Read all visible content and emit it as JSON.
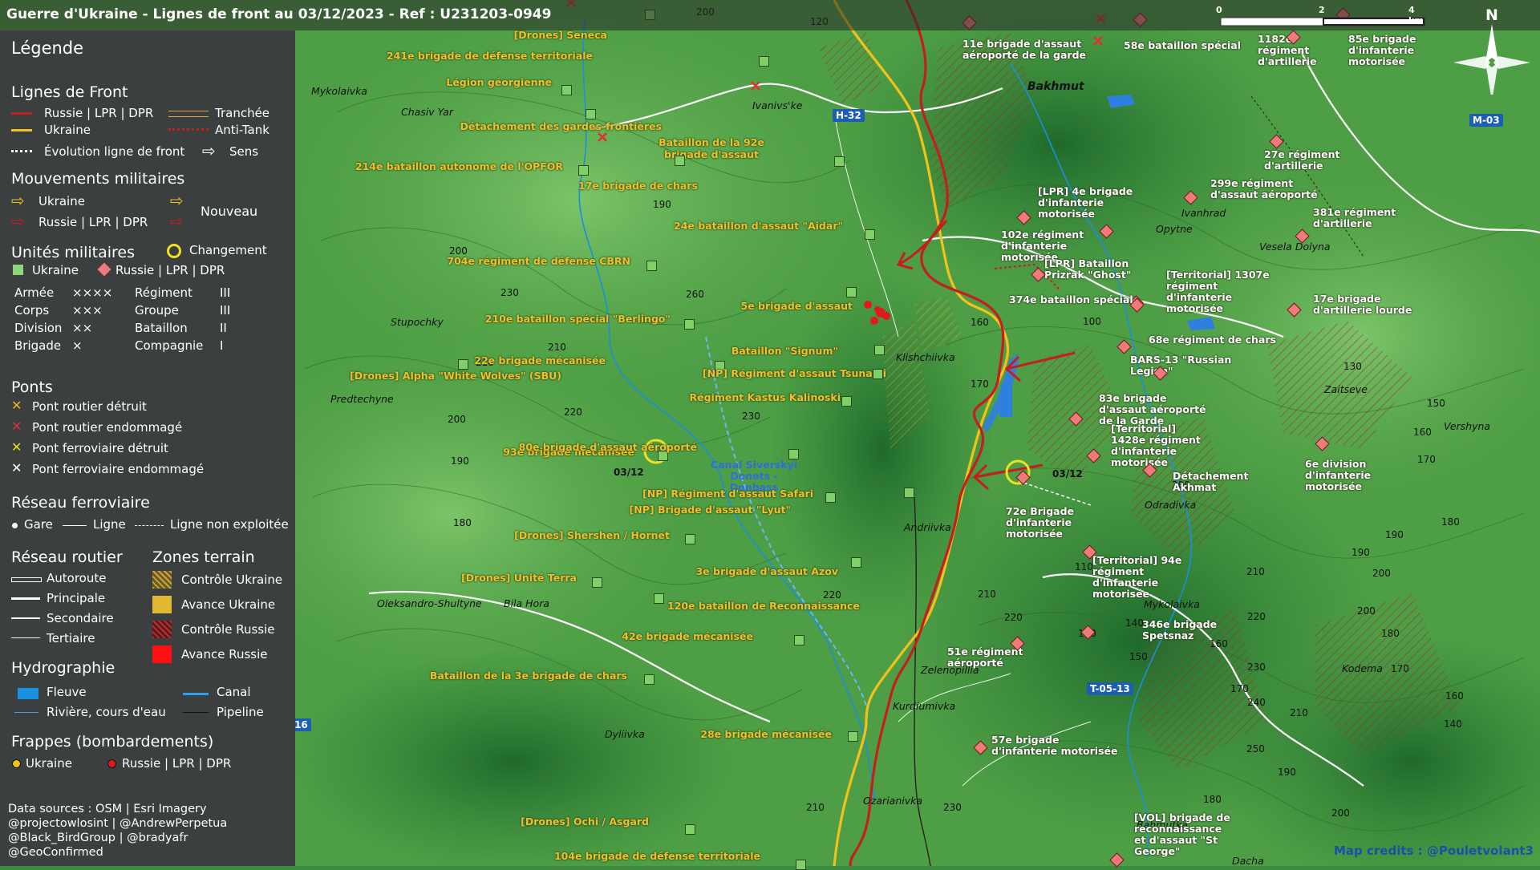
{
  "title": "Guerre d'Ukraine - Lignes de front au 03/12/2023 - Ref : U231203-0949",
  "colors": {
    "ukraine": "#f2c21a",
    "russia": "#c41e1e",
    "hydro": "#1a90e0"
  },
  "legend": {
    "title": "Légende",
    "front_lines": {
      "heading": "Lignes de Front",
      "russia": "Russie | LPR | DPR",
      "ukraine": "Ukraine",
      "trench": "Tranchée",
      "antitank": "Anti-Tank",
      "evolution": "Évolution ligne de front",
      "direction": "Sens"
    },
    "movements": {
      "heading": "Mouvements militaires",
      "ukraine": "Ukraine",
      "russia": "Russie | LPR | DPR",
      "new": "Nouveau"
    },
    "units": {
      "heading": "Unités militaires",
      "change": "Changement",
      "ukraine": "Ukraine",
      "russia": "Russie | LPR | DPR",
      "echelons": [
        {
          "l": "Armée",
          "ls": "××××",
          "r": "Régiment",
          "rs": "III"
        },
        {
          "l": "Corps",
          "ls": "×××",
          "r": "Groupe",
          "rs": "III"
        },
        {
          "l": "Division",
          "ls": "××",
          "r": "Bataillon",
          "rs": "II"
        },
        {
          "l": "Brigade",
          "ls": "×",
          "r": "Compagnie",
          "rs": "I"
        }
      ]
    },
    "bridges": {
      "heading": "Ponts",
      "items": [
        "Pont routier détruit",
        "Pont routier endommagé",
        "Pont ferroviaire détruit",
        "Pont ferroviaire endommagé"
      ]
    },
    "rail": {
      "heading": "Réseau ferroviaire",
      "station": "Gare",
      "line": "Ligne",
      "unused": "Ligne non exploitée"
    },
    "roads": {
      "heading": "Réseau routier",
      "items": [
        "Autoroute",
        "Principale",
        "Secondaire",
        "Tertiaire"
      ]
    },
    "zones": {
      "heading": "Zones terrain",
      "items": [
        "Contrôle Ukraine",
        "Avance Ukraine",
        "Contrôle Russie",
        "Avance Russie"
      ]
    },
    "hydro": {
      "heading": "Hydrographie",
      "river": "Fleuve",
      "canal": "Canal",
      "stream": "Rivière, cours d'eau",
      "pipeline": "Pipeline"
    },
    "strikes": {
      "heading": "Frappes (bombardements)",
      "ukraine": "Ukraine",
      "russia": "Russie | LPR | DPR"
    }
  },
  "credits": {
    "lines": [
      "Data sources : OSM | Esri Imagery",
      "@projectowlosint | @AndrewPerpetua",
      "@Black_BirdGroup | @bradyafr",
      "@GeoConfirmed"
    ],
    "map_credit": "Map credits : @Pouletvolant3"
  },
  "scale": {
    "ticks": [
      "0",
      "2",
      "4 km"
    ]
  },
  "north": "N",
  "roads": [
    "H-32",
    "M-03",
    "T-05-13",
    "T-05-16"
  ],
  "canal_label": "Canal Siverskyi Donets - Donbass",
  "change_date": "03/12",
  "places": [
    "Mykolaivka",
    "Chasiv Yar",
    "Ivanivs'ke",
    "Bakhmut",
    "Stupochky",
    "Predtechyne",
    "Klishchiivka",
    "Opytne",
    "Ivanhrad",
    "Vesela Dolyna",
    "Zaitseve",
    "Vershyna",
    "Andriivka",
    "Odradivka",
    "Oleksandro-Shultyne",
    "Bila Hora",
    "Mykolaivka",
    "Kodema",
    "Zelenopillia",
    "Kurdiumivka",
    "Dyliivka",
    "Ozarianivka",
    "Bahmutka",
    "Dacha"
  ],
  "elevations": [
    "120",
    "200",
    "190",
    "200",
    "230",
    "260",
    "210",
    "230",
    "210",
    "220",
    "200",
    "190",
    "180",
    "220",
    "230",
    "210",
    "160",
    "170",
    "100",
    "130",
    "150",
    "160",
    "170",
    "180",
    "190",
    "200",
    "210",
    "220",
    "110",
    "120",
    "140",
    "150",
    "160",
    "170",
    "200",
    "210",
    "220",
    "230",
    "240",
    "250",
    "180",
    "190",
    "200",
    "210",
    "140",
    "160",
    "170",
    "180",
    "190",
    "200"
  ],
  "ua_units": [
    "[Drones] Seneca",
    "241e brigade de défense territoriale",
    "Légion géorgienne",
    "Détachement des gardes-frontières",
    "Bataillon de la 92e brigade d'assaut",
    "214e bataillon autonome de l'OPFOR",
    "17e brigade de chars",
    "24e bataillon d'assaut \"Aidar\"",
    "704e régiment de défense CBRN",
    "210e bataillon spécial \"Berlingo\"",
    "5e brigade d'assaut",
    "Bataillon \"Signum\"",
    "22e brigade mécanisée",
    "[NP] Régiment d'assaut Tsunami",
    "[Drones] Alpha \"White Wolves\" (SBU)",
    "Régiment Kastus Kalinoski",
    "93e brigade mécanisée",
    "80e brigade d'assaut aéroporté",
    "[NP] Régiment d'assaut Safari",
    "[NP] Brigade d'assaut \"Lyut\"",
    "[Drones] Shershen / Hornet",
    "3e brigade d'assaut Azov",
    "[Drones] Unité Terra",
    "120e bataillon de Reconnaissance",
    "42e brigade mécanisée",
    "Bataillon de la 3e brigade de chars",
    "28e brigade mécanisée",
    "[Drones] Ochi / Asgard",
    "104e brigade de défense territoriale"
  ],
  "ru_units": [
    "11e brigade d'assaut aéroporté de la garde",
    "58e bataillon spécial",
    "1182e régiment d'artillerie",
    "85e brigade d'infanterie motorisée",
    "27e régiment d'artillerie",
    "[LPR] 4e brigade d'infanterie motorisée",
    "299e régiment d'assaut aéroporté",
    "381e régiment d'artillerie",
    "102e régiment d'infanterie motorisée",
    "[LPR] Bataillon Prizrak \"Ghost\"",
    "[Territorial] 1307e régiment d'infanterie motorisée",
    "374e bataillon spécial",
    "17e brigade d'artillerie lourde",
    "68e régiment de chars",
    "BARS-13 \"Russian Legion\"",
    "83e brigade d'assaut aéroporté de la Garde",
    "[Territorial] 1428e régiment d'infanterie motorisée",
    "6e division d'infanterie motorisée",
    "Détachement Akhmat",
    "72e Brigade d'infanterie motorisée",
    "[Territorial] 94e régiment d'infanterie motorisée",
    "346e brigade Spetsnaz",
    "51e régiment aéroporté",
    "57e brigade d'infanterie motorisée",
    "[VOL] brigade de reconnaissance et d'assaut \"St George\""
  ]
}
